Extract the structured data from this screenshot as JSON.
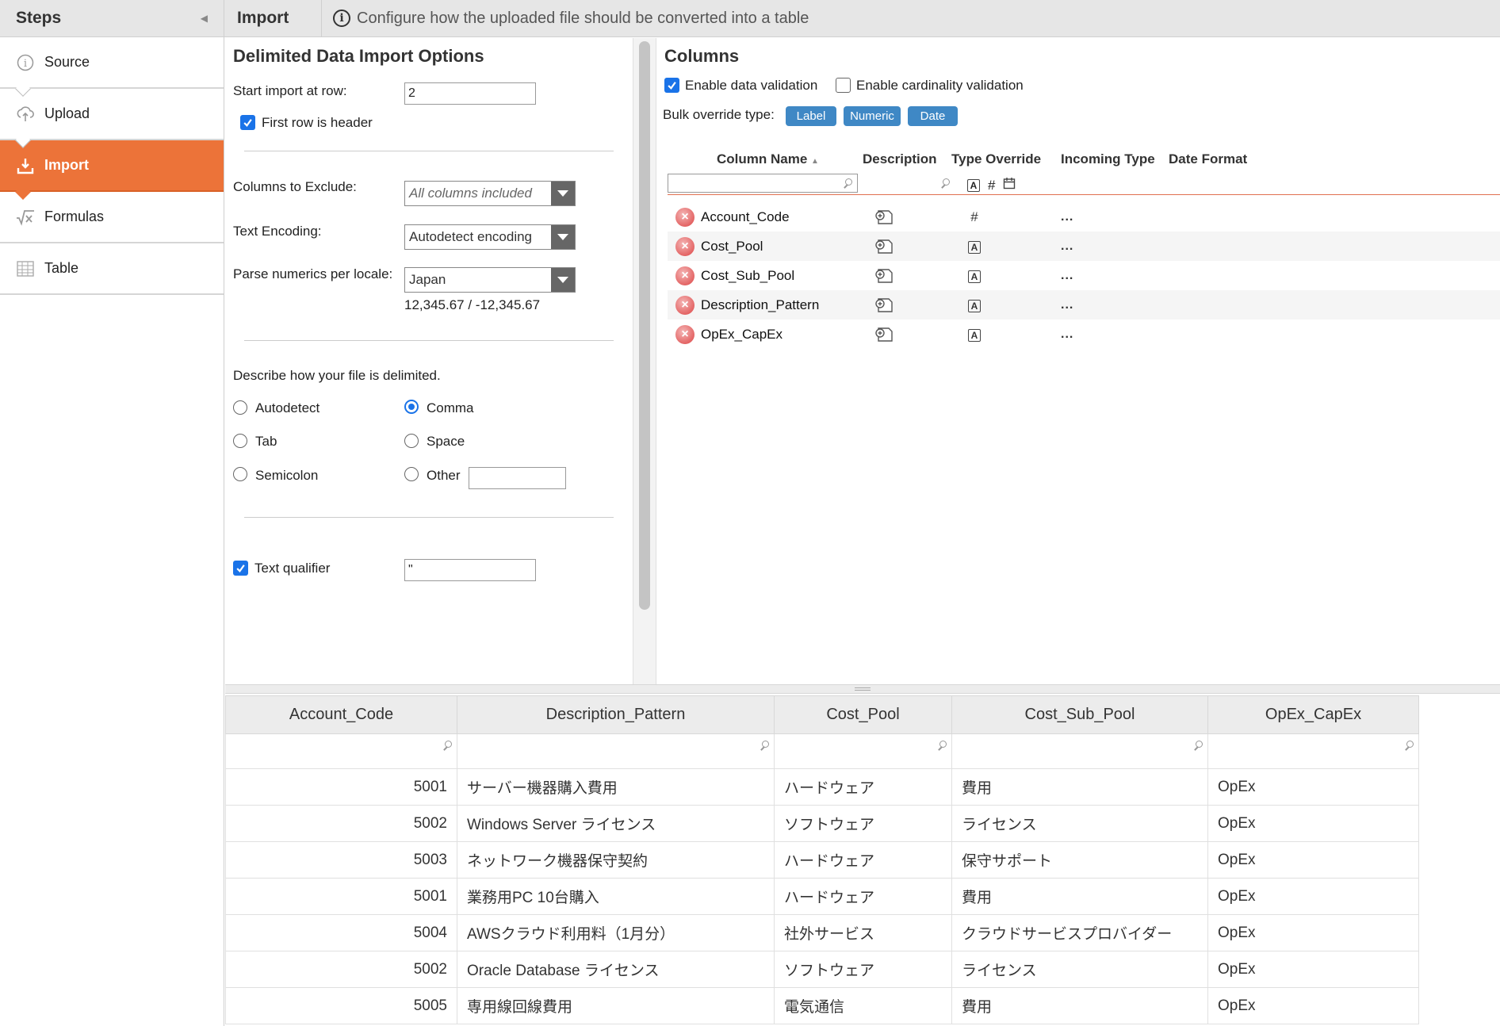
{
  "sidebar": {
    "title": "Steps",
    "steps": [
      {
        "label": "Source",
        "icon": "info-icon"
      },
      {
        "label": "Upload",
        "icon": "cloud-upload-icon"
      },
      {
        "label": "Import",
        "icon": "download-tray-icon"
      },
      {
        "label": "Formulas",
        "icon": "formula-icon"
      },
      {
        "label": "Table",
        "icon": "table-icon"
      }
    ],
    "active_step": "Import",
    "accent_color": "#ec7339"
  },
  "topbar": {
    "title": "Import",
    "info_text": "Configure how the uploaded file should be converted into a table"
  },
  "options": {
    "title": "Delimited Data Import Options",
    "start_row_label": "Start import at row:",
    "start_row_value": "2",
    "first_row_header_label": "First row is header",
    "first_row_header_checked": true,
    "exclude_label": "Columns to Exclude:",
    "exclude_value": "All columns included",
    "encoding_label": "Text Encoding:",
    "encoding_value": "Autodetect encoding",
    "locale_label": "Parse numerics per locale:",
    "locale_value": "Japan",
    "locale_example": "12,345.67 / -12,345.67",
    "delimiter_prompt": "Describe how your file is delimited.",
    "delimiters": {
      "autodetect": "Autodetect",
      "comma": "Comma",
      "tab": "Tab",
      "space": "Space",
      "semicolon": "Semicolon",
      "other": "Other"
    },
    "selected_delimiter": "Comma",
    "other_value": "",
    "text_qualifier_label": "Text qualifier",
    "text_qualifier_checked": true,
    "text_qualifier_value": "\""
  },
  "columns_panel": {
    "title": "Columns",
    "enable_data_validation_label": "Enable data validation",
    "enable_data_validation_checked": true,
    "enable_cardinality_label": "Enable cardinality validation",
    "enable_cardinality_checked": false,
    "bulk_override_label": "Bulk override type:",
    "bulk_buttons": [
      "Label",
      "Numeric",
      "Date"
    ],
    "headers": {
      "column_name": "Column Name",
      "description": "Description",
      "type_override": "Type Override",
      "incoming_type": "Incoming Type",
      "date_format": "Date Format"
    },
    "rows": [
      {
        "name": "Account_Code",
        "type": "numeric",
        "incoming": "..."
      },
      {
        "name": "Cost_Pool",
        "type": "label",
        "incoming": "..."
      },
      {
        "name": "Cost_Sub_Pool",
        "type": "label",
        "incoming": "..."
      },
      {
        "name": "Description_Pattern",
        "type": "label",
        "incoming": "..."
      },
      {
        "name": "OpEx_CapEx",
        "type": "label",
        "incoming": "..."
      }
    ]
  },
  "preview": {
    "headers": [
      "Account_Code",
      "Description_Pattern",
      "Cost_Pool",
      "Cost_Sub_Pool",
      "OpEx_CapEx"
    ],
    "rows": [
      [
        "5001",
        "サーバー機器購入費用",
        "ハードウェア",
        "費用",
        "OpEx"
      ],
      [
        "5002",
        "Windows Server ライセンス",
        "ソフトウェア",
        "ライセンス",
        "OpEx"
      ],
      [
        "5003",
        "ネットワーク機器保守契約",
        "ハードウェア",
        "保守サポート",
        "OpEx"
      ],
      [
        "5001",
        "業務用PC 10台購入",
        "ハードウェア",
        "費用",
        "OpEx"
      ],
      [
        "5004",
        "AWSクラウド利用料（1月分）",
        "社外サービス",
        "クラウドサービスプロバイダー",
        "OpEx"
      ],
      [
        "5002",
        "Oracle Database ライセンス",
        "ソフトウェア",
        "ライセンス",
        "OpEx"
      ],
      [
        "5005",
        "専用線回線費用",
        "電気通信",
        "費用",
        "OpEx"
      ]
    ]
  }
}
